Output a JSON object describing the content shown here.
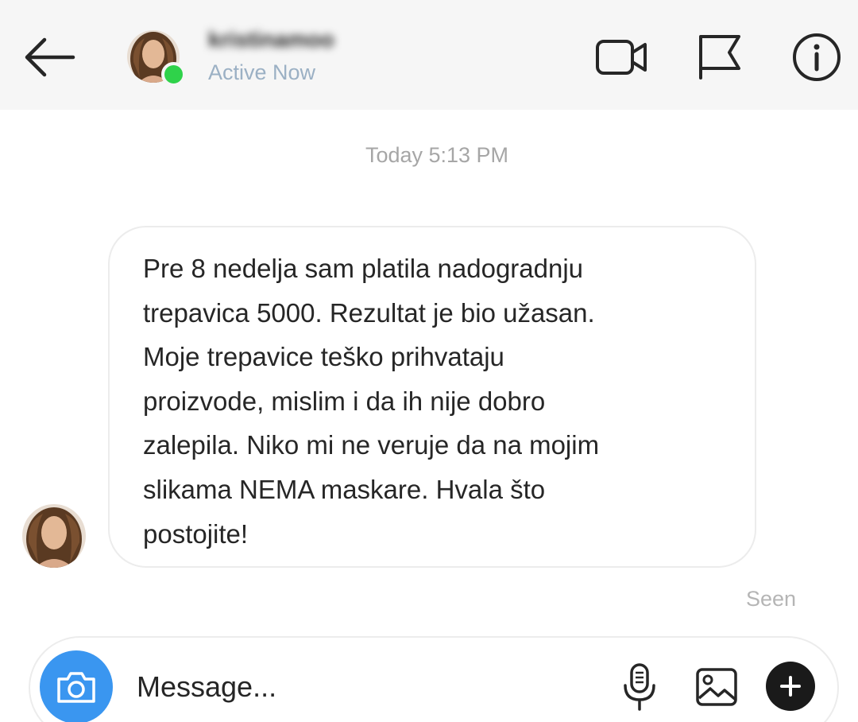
{
  "header": {
    "username": "kristinamoo",
    "status": "Active Now",
    "icons": {
      "back": "arrow-left-icon",
      "video": "video-camera-icon",
      "flag": "flag-icon",
      "info": "info-icon"
    },
    "online_color": "#2fd24a"
  },
  "thread": {
    "timestamp": "Today 5:13 PM",
    "message": {
      "text": "Pre 8 nedelja sam platila nadogradnju\ntrepavica 5000. Rezultat je bio užasan.\nMoje trepavice teško prihvataju\nproizvode, mislim i da ih nije dobro\nzalepila. Niko mi ne veruje da na mojim\nslikama NEMA maskare. Hvala što\npostojite!"
    },
    "seen_label": "Seen"
  },
  "composer": {
    "placeholder": "Message...",
    "camera_color": "#3a96f0",
    "icons": {
      "camera": "camera-icon",
      "mic": "microphone-icon",
      "gallery": "image-icon",
      "plus": "plus-icon"
    }
  }
}
